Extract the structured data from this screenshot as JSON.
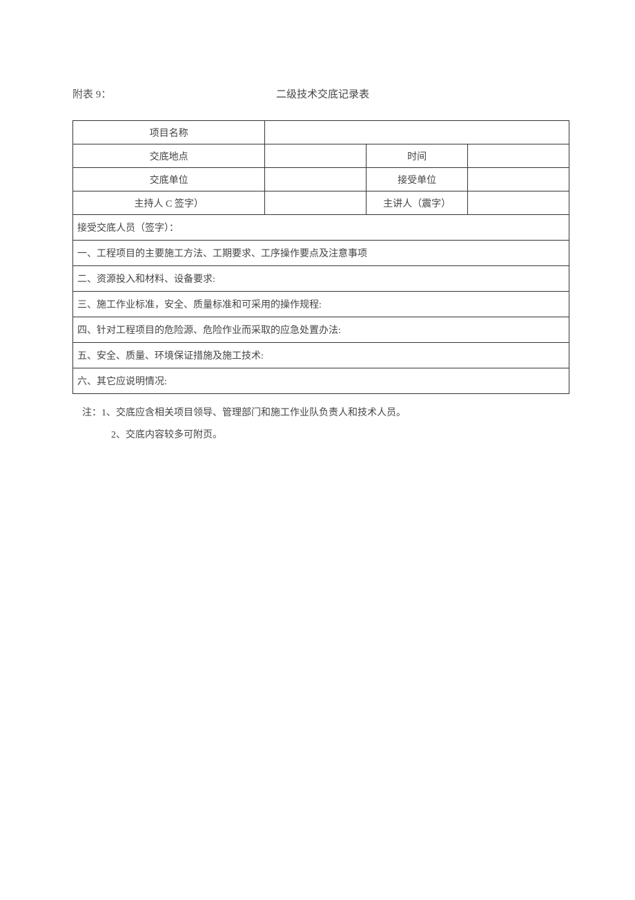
{
  "header": {
    "appendix": "附表 9：",
    "title": "二级技术交底记录表"
  },
  "rows": {
    "project_name_label": "项目名称",
    "location_label": "交底地点",
    "time_label": "时间",
    "unit_label": "交底单位",
    "accept_unit_label": "接受单位",
    "host_label": "主持人 C 签字）",
    "speaker_label": "主讲人（震字）",
    "project_name_value": "",
    "location_value": "",
    "time_value": "",
    "unit_value": "",
    "accept_unit_value": "",
    "host_value": "",
    "speaker_value": ""
  },
  "sections": {
    "signers": "接受交底人员（签字）：",
    "s1": "一、工程项目的主要施工方法、工期要求、工序操作要点及注意事项",
    "s2": "二、资源投入和材料、设备要求:",
    "s3": "三、施工作业标准，安全、质量标准和可采用的操作规程:",
    "s4": "四、针对工程项目的危险源、危险作业而采取的应急处置办法:",
    "s5": "五、安全、质量、环境保证措施及施工技术:",
    "s6": "六、其它应说明情况:"
  },
  "notes": {
    "n1": "注：1、交底应含相关项目领导、管理部门和施工作业队负责人和技术人员。",
    "n2": "2、交底内容较多可附页。"
  }
}
